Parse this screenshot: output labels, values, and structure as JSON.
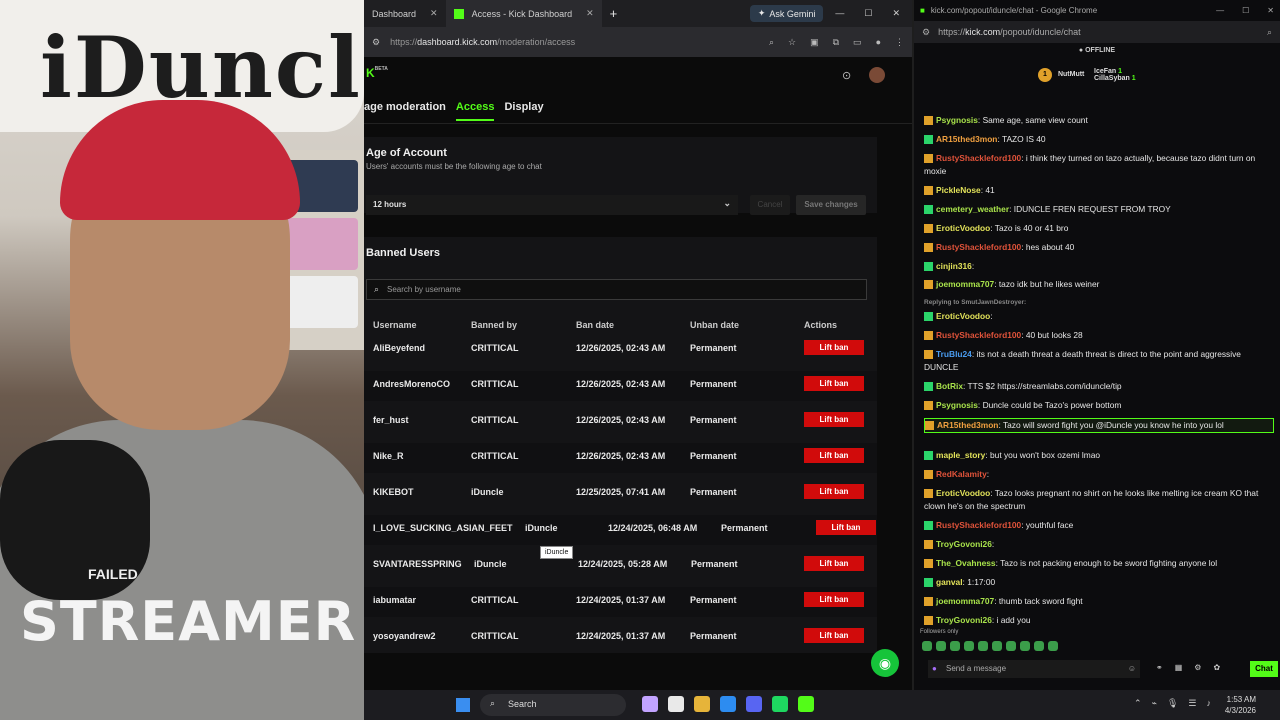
{
  "cam": {
    "board_text": "iDuncle",
    "shirt_text": "STREAMER",
    "shirt_text_small": "FAILED"
  },
  "browser": {
    "tabs": [
      {
        "label": "Dashboard"
      },
      {
        "label": "Access - Kick Dashboard"
      }
    ],
    "new_tab": "+",
    "ask_gemini": "Ask Gemini",
    "url_prefix": "https://",
    "url_host": "dashboard.kick.com",
    "url_path": "/moderation/access"
  },
  "dash": {
    "logo_meta": "BETA",
    "nav": [
      "age moderation",
      "Access",
      "Display"
    ],
    "age_title": "Age of Account",
    "age_sub": "Users' accounts must be the following age to chat",
    "age_value": "12 hours",
    "cancel": "Cancel",
    "save": "Save changes",
    "banned_title": "Banned Users",
    "search_placeholder": "Search by username",
    "columns": [
      "Username",
      "Banned by",
      "Ban date",
      "Unban date",
      "Actions"
    ],
    "rows": [
      {
        "user": "AliBeyefend",
        "by": "CRITTICAL",
        "date": "12/26/2025, 02:43 AM",
        "unban": "Permanent",
        "action": "Lift ban"
      },
      {
        "user": "AndresMorenoCO",
        "by": "CRITTICAL",
        "date": "12/26/2025, 02:43 AM",
        "unban": "Permanent",
        "action": "Lift ban"
      },
      {
        "user": "fer_hust",
        "by": "CRITTICAL",
        "date": "12/26/2025, 02:43 AM",
        "unban": "Permanent",
        "action": "Lift ban"
      },
      {
        "user": "Nike_R",
        "by": "CRITTICAL",
        "date": "12/26/2025, 02:43 AM",
        "unban": "Permanent",
        "action": "Lift ban"
      },
      {
        "user": "KIKEBOT",
        "by": "iDuncle",
        "date": "12/25/2025, 07:41 AM",
        "unban": "Permanent",
        "action": "Lift ban"
      },
      {
        "user": "I_LOVE_SUCKING_ASIAN_FEET",
        "by": "iDuncle",
        "date": "12/24/2025, 06:48 AM",
        "unban": "Permanent",
        "action": "Lift ban"
      },
      {
        "user": "SVANTARESSPRING",
        "by": "iDuncle",
        "date": "12/24/2025, 05:28 AM",
        "unban": "Permanent",
        "action": "Lift ban"
      },
      {
        "user": "iabumatar",
        "by": "CRITTICAL",
        "date": "12/24/2025, 01:37 AM",
        "unban": "Permanent",
        "action": "Lift ban"
      },
      {
        "user": "yosoyandrew2",
        "by": "CRITTICAL",
        "date": "12/24/2025, 01:37 AM",
        "unban": "Permanent",
        "action": "Lift ban"
      }
    ],
    "tooltip": "iDuncle"
  },
  "chat": {
    "title": "kick.com/popout/iduncle/chat - Google Chrome",
    "url_prefix": "https://",
    "url_host": "kick.com",
    "url_path": "/popout/iduncle/chat",
    "status": "OFFLINE",
    "podium": [
      {
        "name": "NutMutt",
        "count": "1"
      },
      {
        "name": "IceFan",
        "count": "1"
      },
      {
        "name": "CillaSyban",
        "count": "1"
      }
    ],
    "messages": [
      {
        "user": "Psygnosis",
        "text": "Same age, same view count",
        "color": "#a9e34b"
      },
      {
        "user": "AR15thed3mon",
        "text": "TAZO IS 40",
        "color": "#f0a040"
      },
      {
        "user": "RustyShackleford100",
        "text": "i think they turned on tazo actually, because tazo didnt turn on moxie",
        "color": "#e0533a"
      },
      {
        "user": "PickleNose",
        "text": "41",
        "color": "#e3e35a"
      },
      {
        "user": "cemetery_weather",
        "text": "IDUNCLE FREN REQUEST FROM TROY",
        "color": "#a9e34b"
      },
      {
        "user": "EroticVoodoo",
        "text": "Tazo is 40 or 41 bro",
        "color": "#e3e35a"
      },
      {
        "user": "RustyShackleford100",
        "text": "hes about 40",
        "color": "#e0533a"
      },
      {
        "user": "cinjin316",
        "text": "",
        "color": "#e3e35a"
      },
      {
        "user": "joemomma707",
        "text": "tazo idk but he likes weiner",
        "color": "#a9e34b"
      },
      {
        "user": "Replying to SmutJawnDestroyer:",
        "text": "",
        "color": "#888"
      },
      {
        "user": "EroticVoodoo",
        "text": "",
        "color": "#e3e35a"
      },
      {
        "user": "RustyShackleford100",
        "text": "40 but looks 28",
        "color": "#e0533a"
      },
      {
        "user": "TruBlu24",
        "text": "its not a death threat a death threat is direct to the point and aggressive DUNCLE",
        "color": "#4a9cf0"
      },
      {
        "user": "BotRix",
        "text": "TTS $2 https://streamlabs.com/iduncle/tip",
        "color": "#a9e34b"
      },
      {
        "user": "Psygnosis",
        "text": "Duncle could be Tazo's power bottom",
        "color": "#a9e34b"
      },
      {
        "user": "AR15thed3mon",
        "text": "Tazo will sword fight you @iDuncle you know he into you lol",
        "color": "#f0a040"
      },
      {
        "user": "maple_story",
        "text": "but you won't box ozemi lmao",
        "color": "#e3e35a"
      },
      {
        "user": "RedKalamity",
        "text": "",
        "color": "#e0533a"
      },
      {
        "user": "EroticVoodoo",
        "text": "Tazo looks pregnant no shirt on he looks like melting ice cream KO that clown he's on the spectrum",
        "color": "#e3e35a"
      },
      {
        "user": "RustyShackleford100",
        "text": "youthful face",
        "color": "#e0533a"
      },
      {
        "user": "TroyGovoni26",
        "text": "",
        "color": "#a9e34b"
      },
      {
        "user": "The_Ovahness",
        "text": "Tazo is not packing enough to be sword fighting anyone lol",
        "color": "#a9e34b"
      },
      {
        "user": "ganval",
        "text": "1:17:00",
        "color": "#e3e35a"
      },
      {
        "user": "joemomma707",
        "text": "thumb tack sword fight",
        "color": "#a9e34b"
      },
      {
        "user": "TroyGovoni26",
        "text": "i add you",
        "color": "#a9e34b"
      }
    ],
    "followers_only": "Followers only",
    "input_placeholder": "Send a message",
    "send_label": "Chat"
  },
  "taskbar": {
    "search": "Search",
    "time": "1:53 AM",
    "date": "4/3/2026"
  }
}
